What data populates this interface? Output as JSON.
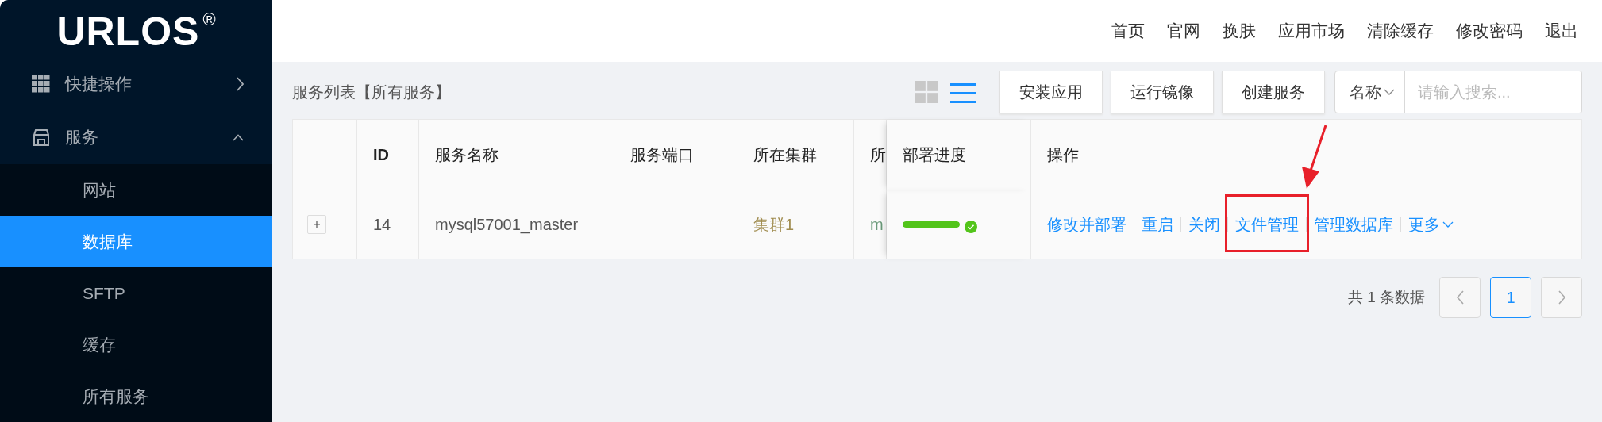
{
  "sidebar": {
    "logo": "URLOS",
    "logo_mark": "®",
    "items": [
      {
        "label": "快捷操作",
        "expanded": false
      },
      {
        "label": "服务",
        "expanded": true,
        "children": [
          {
            "label": "网站",
            "selected": false
          },
          {
            "label": "数据库",
            "selected": true
          },
          {
            "label": "SFTP",
            "selected": false
          },
          {
            "label": "缓存",
            "selected": false
          },
          {
            "label": "所有服务",
            "selected": false
          }
        ]
      }
    ]
  },
  "header": {
    "nav": [
      "首页",
      "官网",
      "换肤",
      "应用市场",
      "清除缓存",
      "修改密码",
      "退出"
    ]
  },
  "toolbar": {
    "title": "服务列表【所有服务】",
    "view_toggles": [
      {
        "selected": false
      },
      {
        "selected": true
      }
    ],
    "buttons": [
      "安装应用",
      "运行镜像",
      "创建服务"
    ],
    "search": {
      "field": "名称",
      "placeholder": "请输入搜索..."
    }
  },
  "table": {
    "columns": [
      "ID",
      "服务名称",
      "服务端口",
      "所在集群",
      "所"
    ],
    "fixed_columns": [
      "部署进度",
      "操作"
    ],
    "rows": [
      {
        "expanded": false,
        "cells": [
          "14",
          "mysql57001_master",
          "",
          "集群1",
          "m"
        ],
        "progress": {
          "level": 1,
          "done": true
        },
        "actions": [
          {
            "label": "修改并部署",
            "highlighted": false,
            "dropdown": false
          },
          {
            "label": "重启",
            "highlighted": false,
            "dropdown": false
          },
          {
            "label": "关闭",
            "highlighted": false,
            "dropdown": false
          },
          {
            "label": "文件管理",
            "highlighted": true,
            "dropdown": false
          },
          {
            "label": "管理数据库",
            "highlighted": false,
            "dropdown": false
          },
          {
            "label": "更多",
            "highlighted": false,
            "dropdown": true
          }
        ]
      }
    ]
  },
  "pagination": {
    "summary": "共 1 条数据",
    "pages": [
      {
        "label": "1",
        "selected": true
      }
    ]
  }
}
